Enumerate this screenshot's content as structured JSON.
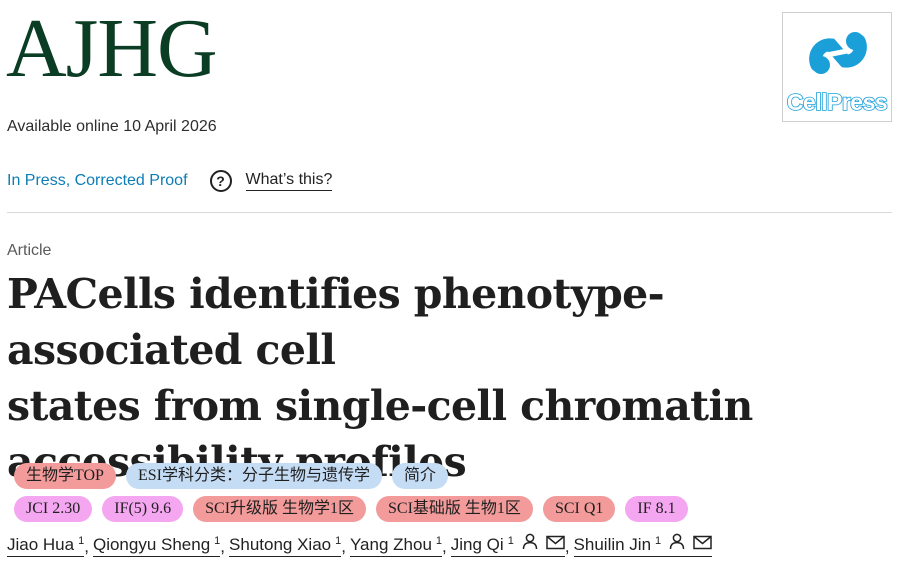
{
  "journal": {
    "name": "AJHG",
    "publisher_logo_text": "CellPress"
  },
  "availability": "Available online 10 April 2026",
  "status": {
    "link": "In Press, Corrected Proof",
    "help_icon": "question-circle-icon",
    "whats_this": "What’s this?"
  },
  "article": {
    "type": "Article",
    "title_lines": [
      "PACells identifies phenotype-associated cell",
      "states from single-cell chromatin",
      "accessibility profiles"
    ]
  },
  "tags": [
    [
      {
        "label": "生物学TOP",
        "color": "#f39b9b"
      },
      {
        "label": "ESI学科分类：分子生物与遗传学",
        "color": "#c5dcf5"
      },
      {
        "label": "简介",
        "color": "#c5dcf5"
      }
    ],
    [
      {
        "label": "JCI 2.30",
        "color": "#f5a6f0"
      },
      {
        "label": "IF(5) 9.6",
        "color": "#f5a6f0"
      },
      {
        "label": "SCI升级版 生物学1区",
        "color": "#f39b9b"
      },
      {
        "label": "SCI基础版 生物1区",
        "color": "#f39b9b"
      },
      {
        "label": "SCI Q1",
        "color": "#f39b9b"
      },
      {
        "label": "IF 8.1",
        "color": "#f5a6f0"
      }
    ]
  ],
  "authors": [
    {
      "name": "Jiao Hua",
      "sup": "1",
      "icons": []
    },
    {
      "name": "Qiongyu Sheng",
      "sup": "1",
      "icons": []
    },
    {
      "name": "Shutong Xiao",
      "sup": "1",
      "icons": []
    },
    {
      "name": "Yang Zhou",
      "sup": "1",
      "icons": []
    },
    {
      "name": "Jing Qi",
      "sup": "1",
      "icons": [
        "person-icon",
        "email-icon"
      ]
    },
    {
      "name": "Shuilin Jin",
      "sup": "1",
      "icons": [
        "person-icon",
        "email-icon"
      ]
    }
  ]
}
